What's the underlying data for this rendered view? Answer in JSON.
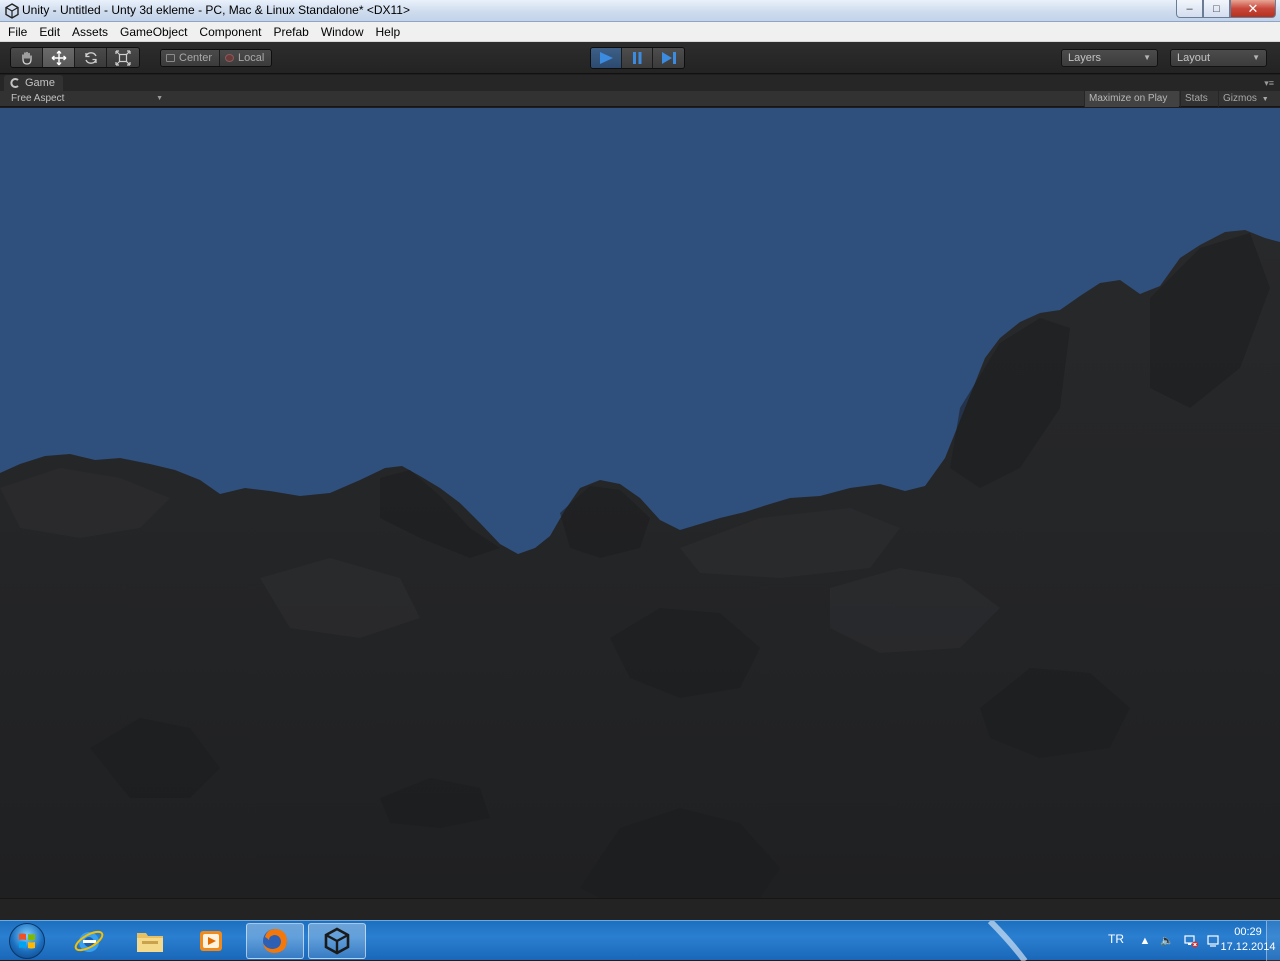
{
  "window": {
    "title": "Unity - Untitled - Unty 3d ekleme - PC, Mac & Linux Standalone* <DX11>",
    "minimize_glyph": "–",
    "maximize_glyph": "□",
    "close_glyph": "✕"
  },
  "menubar": {
    "items": [
      "File",
      "Edit",
      "Assets",
      "GameObject",
      "Component",
      "Prefab",
      "Window",
      "Help"
    ]
  },
  "toolbar": {
    "transform_tools": [
      "hand-icon",
      "move-icon",
      "rotate-icon",
      "scale-icon"
    ],
    "active_tool": "move-icon",
    "pivot_label": "Center",
    "space_label": "Local",
    "play_state": "playing",
    "layers_label": "Layers",
    "layout_label": "Layout"
  },
  "game_panel": {
    "tab_label": "Game",
    "aspect_label": "Free Aspect",
    "maximize_on_play_label": "Maximize on Play",
    "stats_label": "Stats",
    "gizmos_label": "Gizmos"
  },
  "scene": {
    "sky_color": "#2f4f7c",
    "terrain_color": "#252628"
  },
  "taskbar": {
    "pinned": [
      "start-orb",
      "internet-explorer-icon",
      "file-explorer-icon",
      "media-player-icon",
      "firefox-icon",
      "unity-icon"
    ],
    "language": "TR",
    "time": "00:29",
    "date": "17.12.2014",
    "accent": "#1d6fbf"
  }
}
